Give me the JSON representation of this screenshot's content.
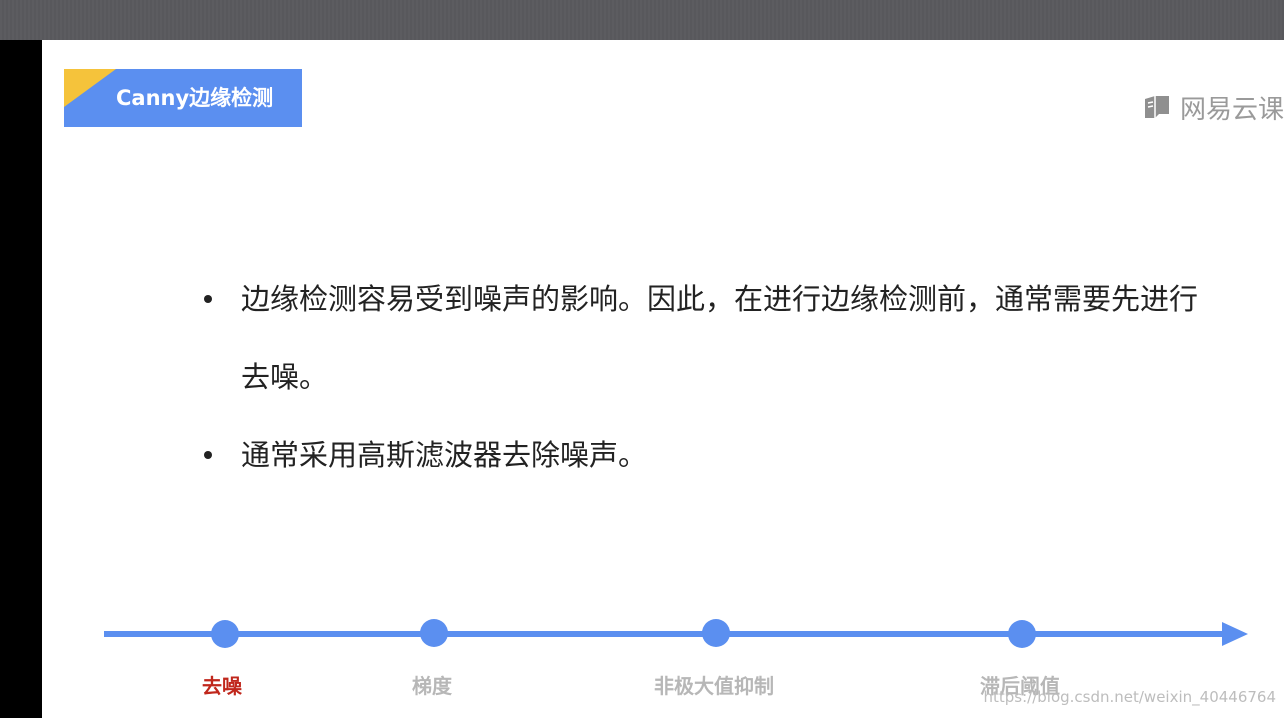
{
  "slide": {
    "title": "Canny边缘检测",
    "brand": "网易云课",
    "bullets": [
      "边缘检测容易受到噪声的影响。因此，在进行边缘检测前，通常需要先进行去噪。",
      "通常采用高斯滤波器去除噪声。"
    ]
  },
  "timeline": {
    "steps": [
      {
        "label": "去噪",
        "active": true
      },
      {
        "label": "梯度",
        "active": false
      },
      {
        "label": "非极大值抑制",
        "active": false
      },
      {
        "label": "滞后阈值",
        "active": false
      }
    ]
  },
  "watermark": "https://blog.csdn.net/weixin_40446764",
  "colors": {
    "title_bg": "#5b8ff0",
    "title_accent": "#f5c33b",
    "timeline": "#5b8ff0",
    "active_step": "#c0271c",
    "inactive_step": "#b7b7b7"
  }
}
